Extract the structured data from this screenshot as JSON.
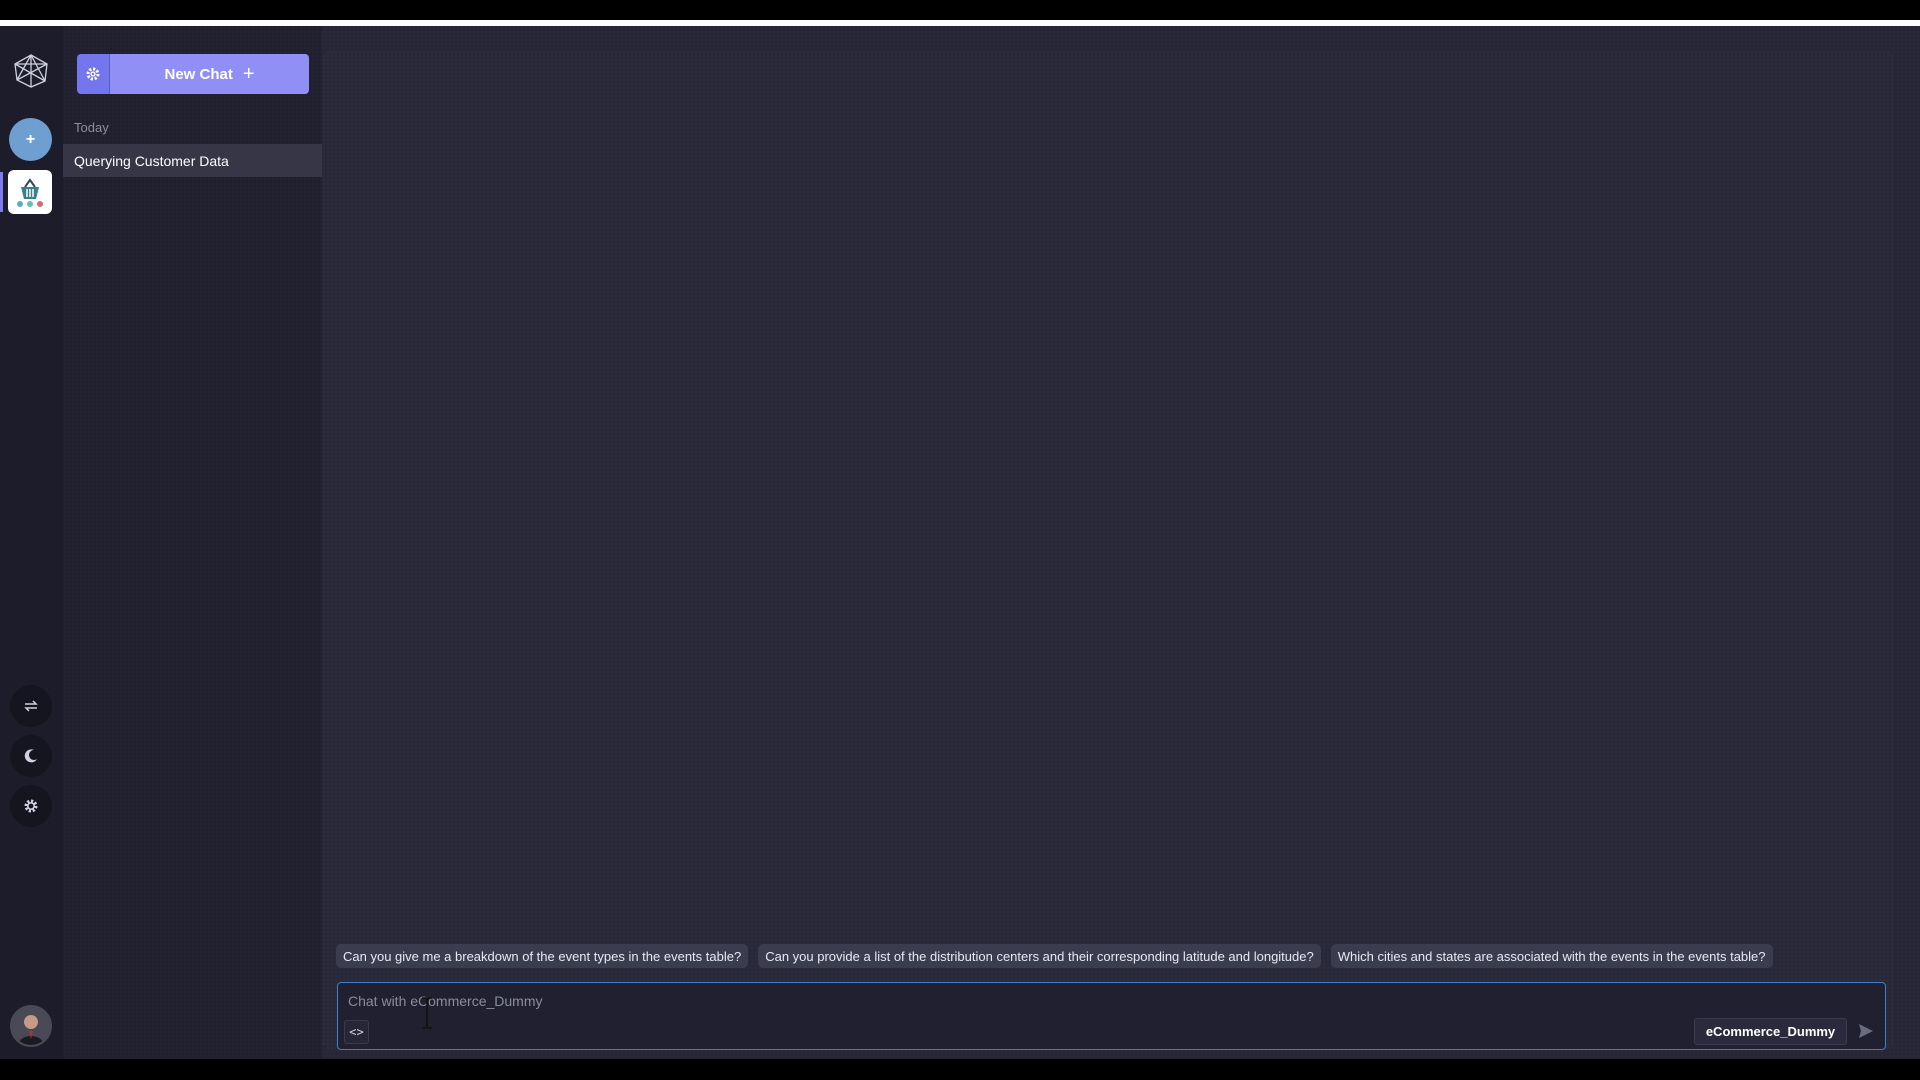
{
  "sidebar": {
    "new_chat_label": "New Chat",
    "section_today": "Today",
    "chats": [
      {
        "title": "Querying Customer Data"
      }
    ]
  },
  "rail": {
    "icons": [
      "network-logo-icon",
      "plus-icon",
      "database-icon",
      "swap-icon",
      "moon-icon",
      "gear-icon",
      "avatar"
    ]
  },
  "main": {
    "suggestions": [
      "Can you give me a breakdown of the event types in the events table?",
      "Can you provide a list of the distribution centers and their corresponding latitude and longitude?",
      "Which cities and states are associated with the events in the events table?"
    ],
    "composer": {
      "placeholder": "Chat with eCommerce_Dummy",
      "code_toggle": "<>",
      "database_name": "eCommerce_Dummy"
    }
  },
  "colors": {
    "accent": "#8f8ff6",
    "focus_border": "#3c7fd0",
    "background": "#262637"
  }
}
